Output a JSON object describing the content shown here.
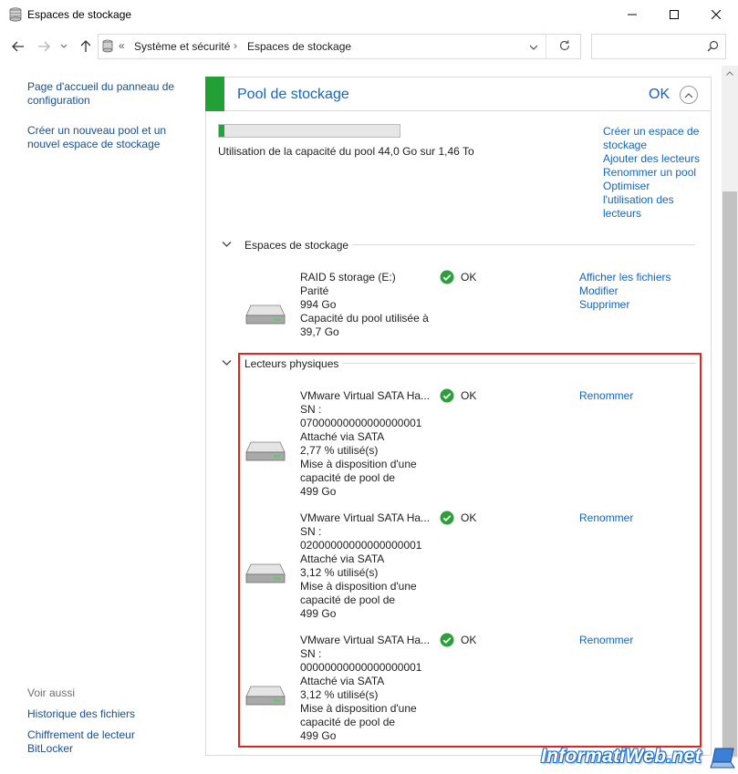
{
  "window": {
    "title": "Espaces de stockage",
    "minimize_icon": "minimize-icon",
    "maximize_icon": "maximize-icon",
    "close_icon": "close-icon"
  },
  "address": {
    "crumb_prefix": "«",
    "crumbs": [
      "Système et sécurité",
      "Espaces de stockage"
    ],
    "separator": "›",
    "search_placeholder": ""
  },
  "left_pane": {
    "links": [
      "Page d'accueil du panneau de configuration",
      "Créer un nouveau pool et un nouvel espace de stockage"
    ],
    "see_also_title": "Voir aussi",
    "see_also_links": [
      "Historique des fichiers",
      "Chiffrement de lecteur BitLocker"
    ]
  },
  "pool": {
    "title": "Pool de stockage",
    "status": "OK",
    "usage_fraction": 0.03,
    "capacity_text": "Utilisation de la capacité du pool 44,0 Go sur 1,46 To",
    "actions": [
      "Créer un espace de stockage",
      "Ajouter des lecteurs",
      "Renommer un pool",
      "Optimiser l'utilisation des lecteurs"
    ]
  },
  "storage_spaces": {
    "section_title": "Espaces de stockage",
    "items": [
      {
        "lines": [
          "RAID 5 storage (E:)",
          "Parité",
          "994 Go",
          "Capacité du pool utilisée à",
          "39,7 Go"
        ],
        "status": "OK",
        "actions": [
          "Afficher les fichiers",
          "Modifier",
          "Supprimer"
        ]
      }
    ]
  },
  "physical_drives": {
    "section_title": "Lecteurs physiques",
    "items": [
      {
        "lines": [
          "VMware Virtual SATA Ha...",
          "SN :",
          "07000000000000000001",
          "Attaché via SATA",
          "2,77 % utilisé(s)",
          "Mise à disposition d'une",
          "capacité de pool de",
          "499 Go"
        ],
        "status": "OK",
        "action": "Renommer"
      },
      {
        "lines": [
          "VMware Virtual SATA Ha...",
          "SN :",
          "02000000000000000001",
          "Attaché via SATA",
          "3,12 % utilisé(s)",
          "Mise à disposition d'une",
          "capacité de pool de",
          "499 Go"
        ],
        "status": "OK",
        "action": "Renommer"
      },
      {
        "lines": [
          "VMware Virtual SATA Ha...",
          "SN :",
          "00000000000000000001",
          "Attaché via SATA",
          "3,12 % utilisé(s)",
          "Mise à disposition d'une",
          "capacité de pool de",
          "499 Go"
        ],
        "status": "OK",
        "action": "Renommer"
      }
    ]
  },
  "watermark": "InformatiWeb.net",
  "colors": {
    "accent_blue": "#1565c0",
    "status_green": "#23a035",
    "highlight_red": "#e0241f"
  }
}
